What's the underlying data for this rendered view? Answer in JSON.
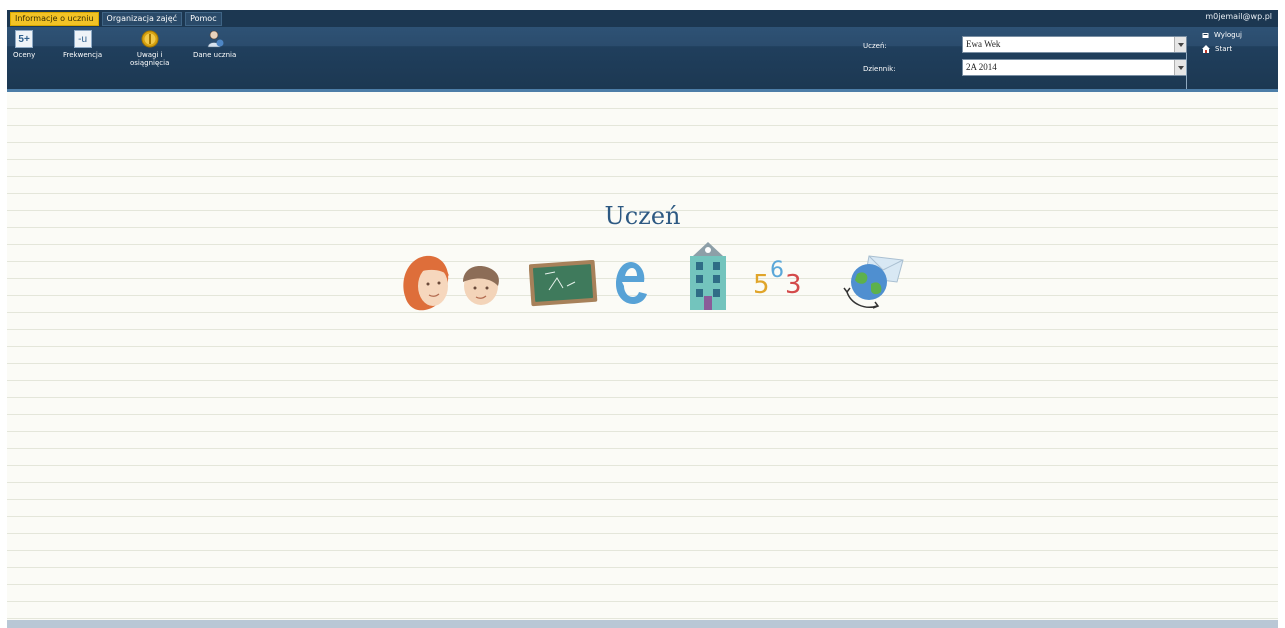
{
  "tabs": [
    {
      "label": "Informacje o uczniu",
      "active": true
    },
    {
      "label": "Organizacja zajęć",
      "active": false
    },
    {
      "label": "Pomoc",
      "active": false
    }
  ],
  "user_email": "m0jemail@wp.pl",
  "toolbar": {
    "oceny": {
      "icon": "grades-icon",
      "icon_text": "5+",
      "label": "Oceny"
    },
    "frekwencja": {
      "icon": "attendance-icon",
      "icon_text": "-u",
      "label": "Frekwencja"
    },
    "uwagi": {
      "icon": "notes-medal-icon",
      "label_line1": "Uwagi i",
      "label_line2": "osiągnięcia"
    },
    "dane": {
      "icon": "student-data-icon",
      "label": "Dane ucznia"
    }
  },
  "selectors": {
    "uczen_label": "Uczeń:",
    "uczen_value": "Ewa Wek",
    "dziennik_label": "Dziennik:",
    "dziennik_value": "2A 2014"
  },
  "links": {
    "wyloguj": "Wyloguj",
    "start": "Start"
  },
  "main": {
    "title": "Uczeń",
    "icons": [
      "students-icon",
      "chalkboard-icon",
      "e-letter-icon",
      "school-building-icon",
      "numbers-icon",
      "globe-mail-icon"
    ],
    "numbers_icon_text": [
      "5",
      "6",
      "3"
    ]
  },
  "colors": {
    "header_dark": "#1c3751",
    "active_tab": "#f2c326",
    "title_blue": "#2d5982"
  }
}
